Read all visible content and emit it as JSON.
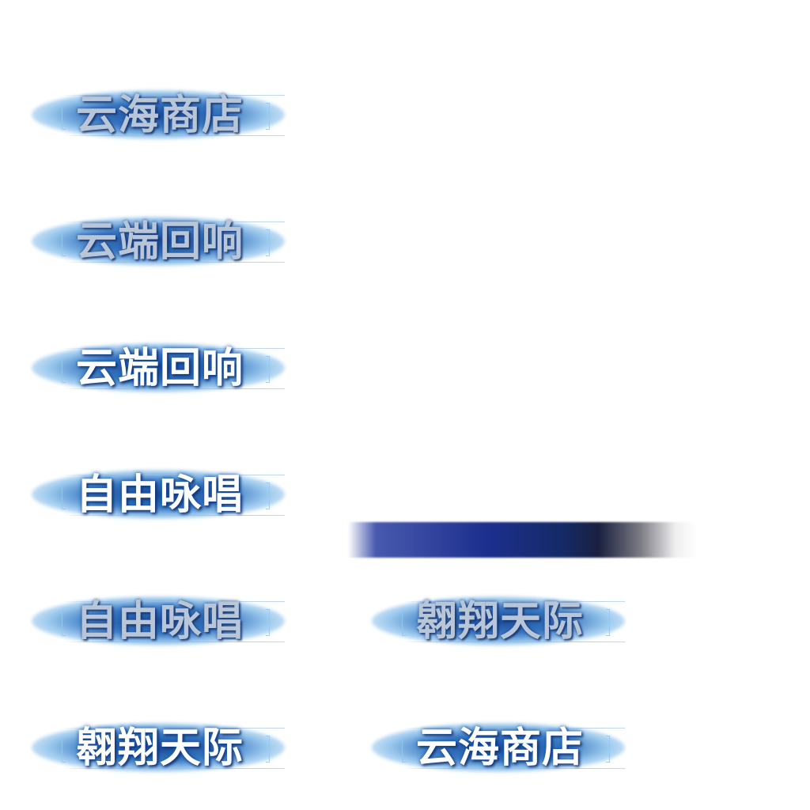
{
  "buttons": [
    {
      "label": "云海商店",
      "state": "normal"
    },
    {
      "label": "云端回响",
      "state": "normal"
    },
    {
      "label": "云端回响",
      "state": "highlighted"
    },
    {
      "label": "自由咏唱",
      "state": "highlighted"
    },
    {
      "label": "自由咏唱",
      "state": "normal"
    },
    {
      "label": "翱翔天际",
      "state": "normal"
    },
    {
      "label": "翱翔天际",
      "state": "highlighted"
    },
    {
      "label": "云海商店",
      "state": "highlighted"
    }
  ],
  "colors": {
    "glow_core": "#1446a0",
    "text_dim": "#b9c6d8",
    "text_bright": "#ffffff",
    "bar_blue": "#1c2f8e"
  }
}
